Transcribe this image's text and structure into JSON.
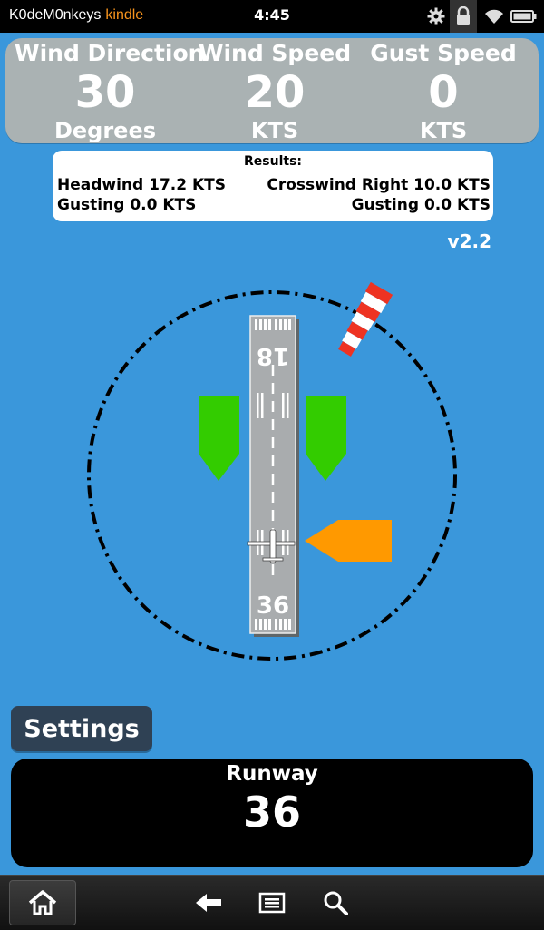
{
  "status_bar": {
    "carrier": "K0deM0nkeys",
    "brand": "kindle",
    "time": "4:45"
  },
  "wind": {
    "direction": {
      "label": "Wind Direction",
      "value": "30",
      "unit": "Degrees"
    },
    "speed": {
      "label": "Wind Speed",
      "value": "20",
      "unit": "KTS"
    },
    "gust": {
      "label": "Gust Speed",
      "value": "0",
      "unit": "KTS"
    }
  },
  "results": {
    "title": "Results:",
    "headwind": "Headwind 17.2 KTS",
    "headwind_gusting": "Gusting 0.0 KTS",
    "crosswind": "Crosswind Right 10.0 KTS",
    "crosswind_gusting": "Gusting 0.0 KTS"
  },
  "version": "v2.2",
  "runway_diagram": {
    "top_number": "18",
    "bottom_number": "36",
    "wind_direction_degrees": 30,
    "headwind_arrow_color": "#33cc00",
    "crosswind_arrow_color": "#ff9900"
  },
  "settings": {
    "label": "Settings"
  },
  "runway": {
    "label": "Runway",
    "value": "36"
  },
  "nav": {
    "icons": [
      "home-icon",
      "back-icon",
      "menu-icon",
      "search-icon"
    ]
  },
  "colors": {
    "background": "#3a97db",
    "panel": "#aab2b3",
    "settings_button": "#2f4154",
    "kindle_brand": "#f7941d"
  }
}
